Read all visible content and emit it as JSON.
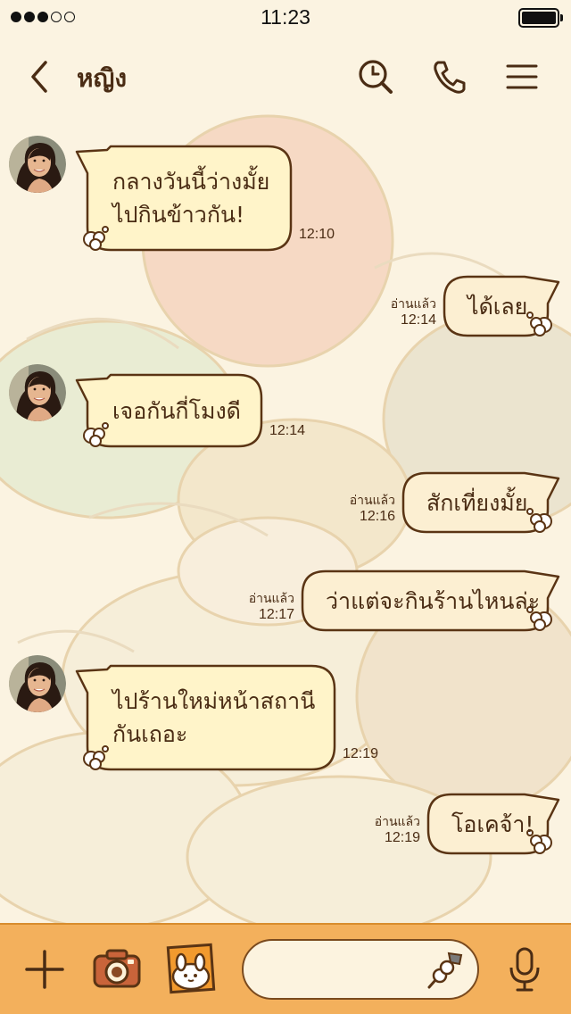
{
  "status_bar": {
    "time": "11:23",
    "signal_dots_filled": 3,
    "signal_dots_total": 5
  },
  "header": {
    "title": "หญิง",
    "back_icon": "chevron-left-icon",
    "search_icon": "search-icon",
    "call_icon": "phone-icon",
    "menu_icon": "menu-icon"
  },
  "messages": [
    {
      "side": "in",
      "lines": [
        "กลางวันนี้ว่างมั้ย",
        "ไปกินข้าวกัน!"
      ],
      "time": "12:10"
    },
    {
      "side": "out",
      "lines": [
        "ได้เลย"
      ],
      "read": "อ่านแล้ว",
      "time": "12:14"
    },
    {
      "side": "in",
      "lines": [
        "เจอกันกี่โมงดี"
      ],
      "time": "12:14"
    },
    {
      "side": "out",
      "lines": [
        "สักเที่ยงมั้ย"
      ],
      "read": "อ่านแล้ว",
      "time": "12:16"
    },
    {
      "side": "out",
      "lines": [
        "ว่าแต่จะกินร้านไหนล่ะ"
      ],
      "read": "อ่านแล้ว",
      "time": "12:17"
    },
    {
      "side": "in",
      "lines": [
        "ไปร้านใหม่หน้าสถานี",
        "กันเถอะ"
      ],
      "time": "12:19"
    },
    {
      "side": "out",
      "lines": [
        "โอเคจ้า!"
      ],
      "read": "อ่านแล้ว",
      "time": "12:19"
    }
  ],
  "bottom_bar": {
    "add_icon": "plus-icon",
    "camera_icon": "camera-icon",
    "sticker_icon": "sticker-icon",
    "input_value": "",
    "input_decoration_icon": "dango-icon",
    "mic_icon": "microphone-icon"
  },
  "colors": {
    "bubble_in": "#fff4c9",
    "bubble_out": "#fcefd2",
    "bubble_stroke": "#5a3414",
    "bottom_bar": "#f3b05c",
    "background": "#fbf3e1"
  }
}
